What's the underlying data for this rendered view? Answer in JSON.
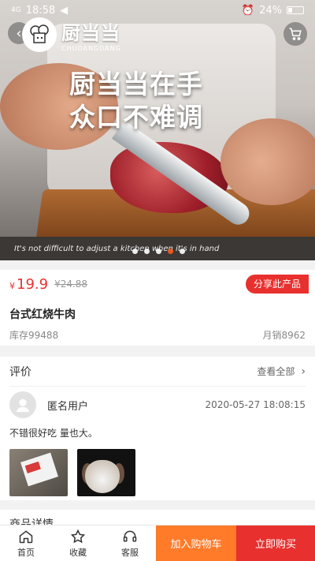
{
  "status_bar": {
    "time": "18:58",
    "signal_label": "4G",
    "battery": "24%"
  },
  "header": {
    "logo_cn": "厨当当",
    "logo_en": "CHUDANGDANG"
  },
  "banner": {
    "slogan_line1": "厨当当在手",
    "slogan_line2": "众口不难调",
    "subtitle": "It's not difficult to adjust a kitchen when it's in hand",
    "dot_count": 5,
    "active_dot": 4
  },
  "product": {
    "currency": "¥",
    "price": "19.9",
    "original_price": "¥24.88",
    "share_label": "分享此产品",
    "name": "台式红烧牛肉",
    "stock": "库存99488",
    "monthly_sales": "月销8962"
  },
  "reviews": {
    "title": "评价",
    "view_all": "查看全部",
    "items": [
      {
        "user": "匿名用户",
        "date": "2020-05-27 18:08:15",
        "text": "不错很好吃 量也大。"
      }
    ]
  },
  "details": {
    "title": "商品详情"
  },
  "bottom_bar": {
    "home": "首页",
    "favorite": "收藏",
    "service": "客服",
    "add_to_cart": "加入购物车",
    "buy_now": "立即购买"
  },
  "colors": {
    "accent_red": "#e8302f",
    "accent_orange": "#ff7b2a",
    "active_dot": "#ff5a1f"
  }
}
